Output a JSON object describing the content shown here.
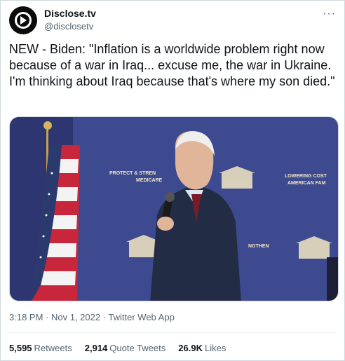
{
  "account": {
    "name": "Disclose.tv",
    "handle": "@disclosetv",
    "more_label": "···"
  },
  "tweet": {
    "text": "NEW - Biden: \"Inflation is a worldwide problem right now because of a war in Iraq... excuse me, the war in Ukraine. I'm thinking about Iraq because that's where my son died.\"",
    "timestamp": "3:18 PM · Nov 1, 2022 · Twitter Web App"
  },
  "media": {
    "backdrop_left_text_1": "PROTECT & STREN",
    "backdrop_left_text_2": "MEDICARE",
    "backdrop_right_text_1": "LOWERING COST",
    "backdrop_right_text_2": "AMERICAN FAM",
    "backdrop_lower_text": "NGTHEN",
    "colors": {
      "backdrop": "#3d4a8f",
      "backdrop_text": "#f4e7c3",
      "suit": "#232c45"
    }
  },
  "engagement": {
    "retweets_count": "5,595",
    "retweets_label": "Retweets",
    "quotes_count": "2,914",
    "quotes_label": "Quote Tweets",
    "likes_count": "26.9K",
    "likes_label": "Likes"
  }
}
